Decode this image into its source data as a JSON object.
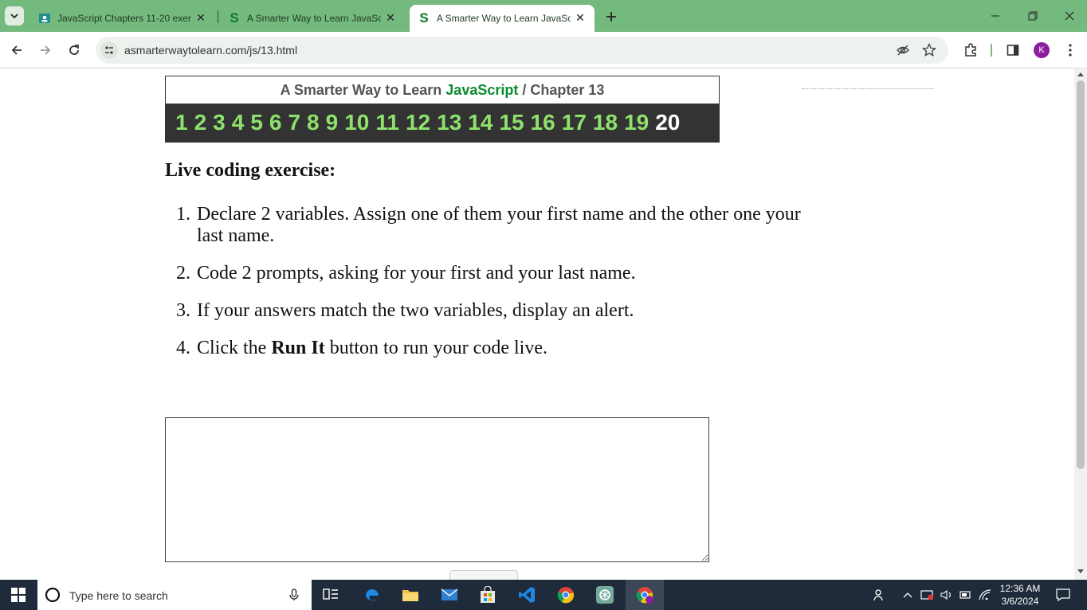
{
  "tabs": [
    {
      "title": "JavaScript Chapters 11-20 exerc",
      "icon": "classroom-icon"
    },
    {
      "title": "A Smarter Way to Learn JavaScr",
      "icon": "s-logo-icon"
    },
    {
      "title": "A Smarter Way to Learn JavaScr",
      "icon": "s-logo-icon",
      "active": true
    }
  ],
  "toolbar": {
    "url": "asmarterwaytolearn.com/js/13.html",
    "profile_initial": "K"
  },
  "page": {
    "header": {
      "prefix": "A Smarter Way to Learn ",
      "brand": "JavaScript",
      "separator": " / ",
      "chapter": "Chapter 13"
    },
    "chapters": [
      "1",
      "2",
      "3",
      "4",
      "5",
      "6",
      "7",
      "8",
      "9",
      "10",
      "11",
      "12",
      "13",
      "14",
      "15",
      "16",
      "17",
      "18",
      "19",
      "20"
    ],
    "current_chapter": "20",
    "exercise_title": "Live coding exercise:",
    "steps": [
      {
        "num": "1.",
        "text": "Declare 2 variables. Assign one of them your first name and the other one your last name."
      },
      {
        "num": "2.",
        "text": "Code 2 prompts, asking for your first and your last name."
      },
      {
        "num": "3.",
        "text": "If your answers match the two variables, display an alert."
      },
      {
        "num": "4.",
        "pre": "Click the ",
        "bold": "Run It",
        "post": " button to run your code live."
      }
    ],
    "code_value": ""
  },
  "taskbar": {
    "search_placeholder": "Type here to search",
    "time": "12:36 AM",
    "date": "3/6/2024"
  },
  "colors": {
    "tabstrip": "#74b97e",
    "chapter_link": "#8ee26c",
    "brand_green": "#0b8a30",
    "taskbar": "#1f2b3a"
  }
}
